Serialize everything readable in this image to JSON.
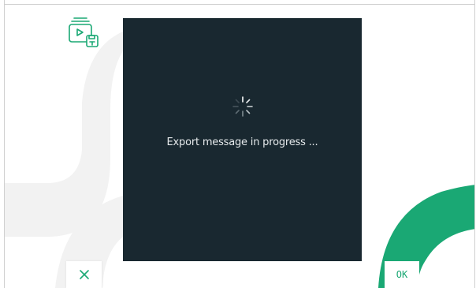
{
  "theme": {
    "accent": "#1aa874",
    "dialog_bg": "#192830",
    "deco_gray": "#f1f1f1",
    "background": "#ffffff"
  },
  "icons": {
    "app": "video-message-save-icon",
    "spinner": "loading-spinner-icon",
    "cancel": "close-icon"
  },
  "dialog": {
    "message": "Export message in progress ..."
  },
  "footer": {
    "ok_label": "OK"
  }
}
